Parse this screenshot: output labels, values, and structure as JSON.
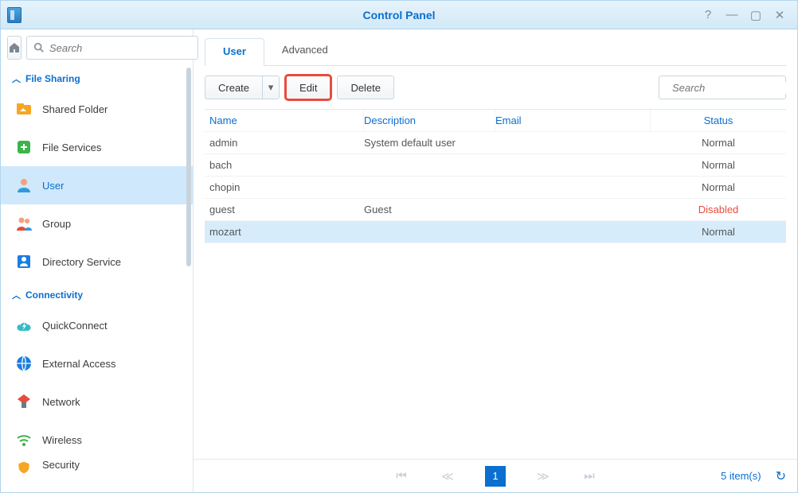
{
  "window": {
    "title": "Control Panel"
  },
  "sidebar": {
    "search_placeholder": "Search",
    "sections": [
      {
        "title": "File Sharing",
        "items": [
          {
            "label": "Shared Folder",
            "icon": "shared-folder-icon"
          },
          {
            "label": "File Services",
            "icon": "file-services-icon"
          },
          {
            "label": "User",
            "icon": "user-icon",
            "active": true
          },
          {
            "label": "Group",
            "icon": "group-icon"
          },
          {
            "label": "Directory Service",
            "icon": "directory-service-icon"
          }
        ]
      },
      {
        "title": "Connectivity",
        "items": [
          {
            "label": "QuickConnect",
            "icon": "quickconnect-icon"
          },
          {
            "label": "External Access",
            "icon": "external-access-icon"
          },
          {
            "label": "Network",
            "icon": "network-icon"
          },
          {
            "label": "Wireless",
            "icon": "wireless-icon"
          },
          {
            "label": "Security",
            "icon": "security-icon"
          }
        ]
      }
    ]
  },
  "main": {
    "tabs": [
      {
        "label": "User",
        "active": true
      },
      {
        "label": "Advanced"
      }
    ],
    "toolbar": {
      "create_label": "Create",
      "edit_label": "Edit",
      "delete_label": "Delete",
      "filter_placeholder": "Search"
    },
    "columns": {
      "name": "Name",
      "description": "Description",
      "email": "Email",
      "status": "Status"
    },
    "rows": [
      {
        "name": "admin",
        "description": "System default user",
        "email": "",
        "status": "Normal"
      },
      {
        "name": "bach",
        "description": "",
        "email": "",
        "status": "Normal"
      },
      {
        "name": "chopin",
        "description": "",
        "email": "",
        "status": "Normal"
      },
      {
        "name": "guest",
        "description": "Guest",
        "email": "",
        "status": "Disabled"
      },
      {
        "name": "mozart",
        "description": "",
        "email": "",
        "status": "Normal",
        "selected": true
      }
    ],
    "pager": {
      "current": "1",
      "summary": "5 item(s)"
    }
  }
}
